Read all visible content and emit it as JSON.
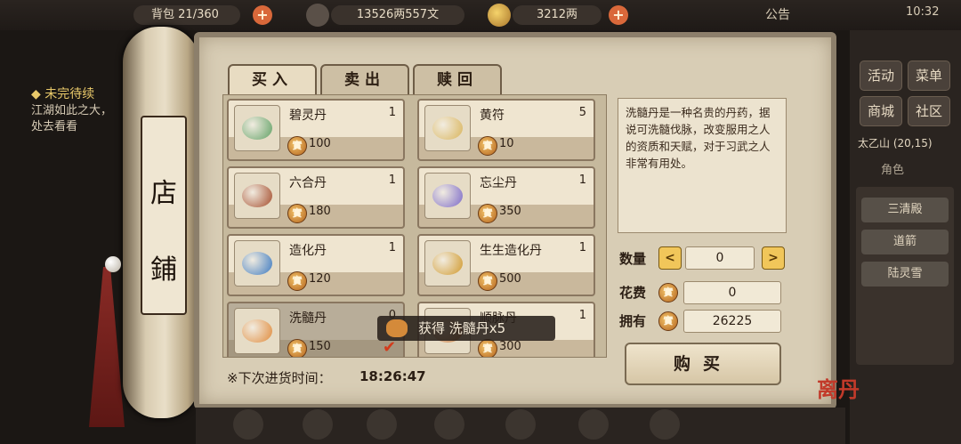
{
  "hud": {
    "bag_label": "背包",
    "bag_count": "21/360",
    "silver": "13526两557文",
    "gold": "3212两",
    "notice": "公告",
    "clock": "10:32"
  },
  "quest": {
    "title": "◆ 未完待续",
    "text": "江湖如此之大，处去看看"
  },
  "right_menu": {
    "activity": "活动",
    "menu": "菜单",
    "mall": "商城",
    "community": "社区",
    "location": "太乙山",
    "coords": "(20,15)",
    "role": "角色",
    "list": [
      "三清殿",
      "道箭",
      "陆灵雪"
    ]
  },
  "shop": {
    "title_chars": [
      "店",
      "鋪"
    ],
    "tabs": [
      "买入",
      "卖出",
      "赎回"
    ],
    "active_tab": 0,
    "items": [
      {
        "name": "碧灵丹",
        "qty": "1",
        "price": "100",
        "color": "#5fa064"
      },
      {
        "name": "黄符",
        "qty": "5",
        "price": "10",
        "color": "#d9b45a"
      },
      {
        "name": "六合丹",
        "qty": "1",
        "price": "180",
        "color": "#a34a2a"
      },
      {
        "name": "忘尘丹",
        "qty": "1",
        "price": "350",
        "color": "#7a68c8"
      },
      {
        "name": "造化丹",
        "qty": "1",
        "price": "120",
        "color": "#3a78c0"
      },
      {
        "name": "生生造化丹",
        "qty": "1",
        "price": "500",
        "color": "#d0982a"
      },
      {
        "name": "洗髓丹",
        "qty": "0",
        "price": "150",
        "color": "#e08a3a"
      },
      {
        "name": "顺脉丹",
        "qty": "1",
        "price": "300",
        "color": "#c97a3a"
      }
    ],
    "selected_index": 6,
    "coin_glyph": "實",
    "description": "洗髓丹是一种名贵的丹药，据说可洗髓伐脉，改变服用之人的资质和天赋，对于习武之人非常有用处。",
    "quantity_label": "数量",
    "quantity_value": "0",
    "cost_label": "花费",
    "cost_value": "0",
    "own_label": "拥有",
    "own_value": "26225",
    "buy_label": "购买",
    "restock_label": "※下次进货时间：",
    "restock_time": "18:26:47",
    "toast": "获得 洗髓丹x5",
    "logo": "离丹"
  }
}
